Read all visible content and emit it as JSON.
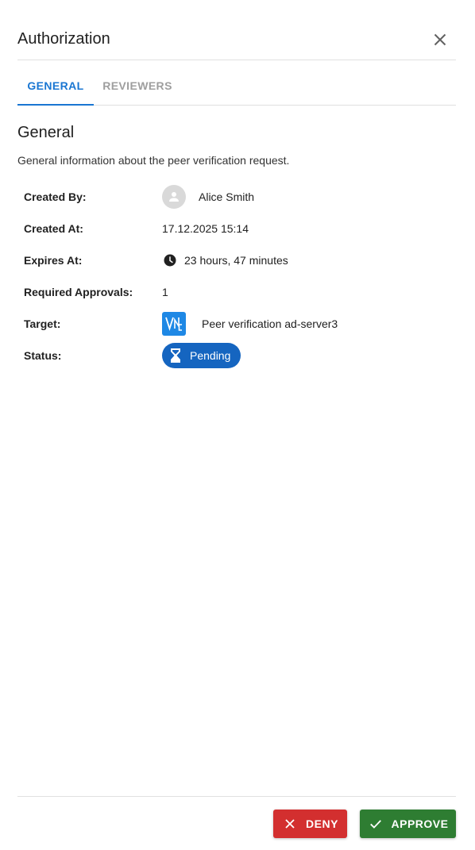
{
  "dialog": {
    "title": "Authorization"
  },
  "tabs": [
    {
      "label": "GENERAL",
      "active": true
    },
    {
      "label": "REVIEWERS",
      "active": false
    }
  ],
  "section": {
    "title": "General",
    "description": "General information about the peer verification request."
  },
  "details": {
    "created_by": {
      "label": "Created By:",
      "value": "Alice Smith",
      "icon": "person-icon"
    },
    "created_at": {
      "label": "Created At:",
      "value": "17.12.2025 15:14"
    },
    "expires_at": {
      "label": "Expires At:",
      "value": "23 hours, 47 minutes",
      "icon": "clock-icon"
    },
    "required_approvals": {
      "label": "Required Approvals:",
      "value": "1"
    },
    "target": {
      "label": "Target:",
      "value": "Peer verification ad-server3",
      "icon": "vnc-icon"
    },
    "status": {
      "label": "Status:",
      "value": "Pending",
      "icon": "hourglass-icon"
    }
  },
  "actions": {
    "deny_label": "DENY",
    "approve_label": "APPROVE"
  },
  "colors": {
    "primary": "#1976d2",
    "status_chip": "#1565c0",
    "deny": "#d32f2f",
    "approve": "#2e7d32"
  }
}
